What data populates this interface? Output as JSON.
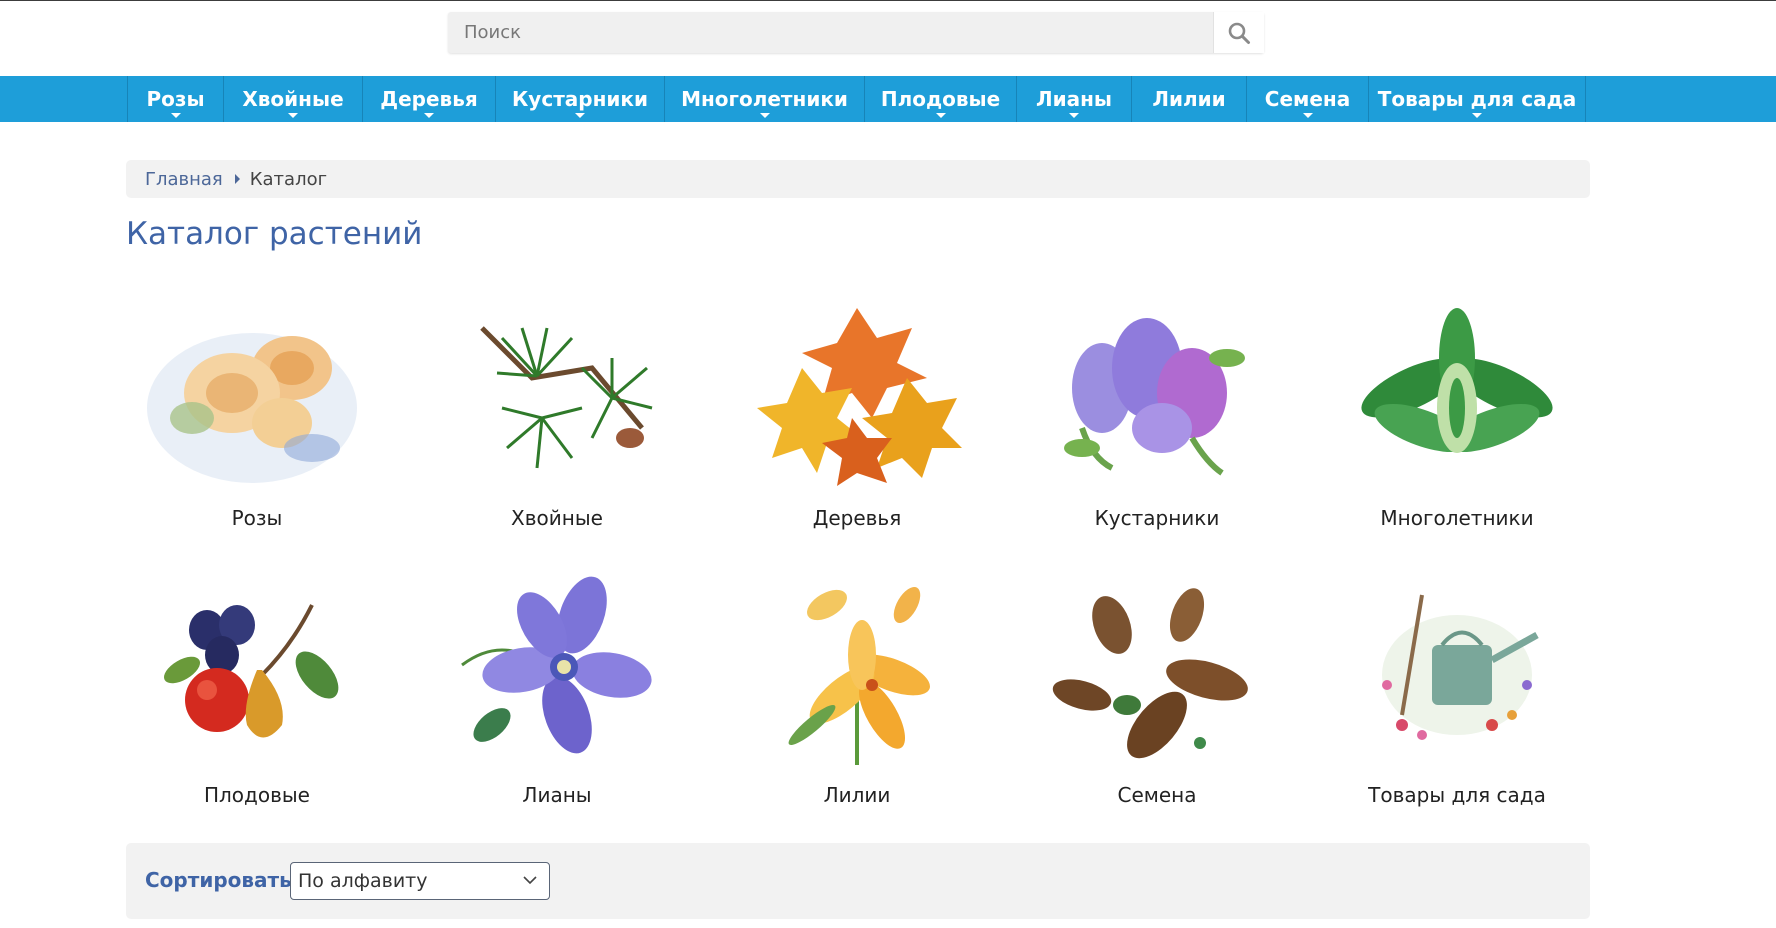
{
  "search": {
    "placeholder": "Поиск",
    "value": ""
  },
  "nav": [
    {
      "label": "Розы",
      "has_dropdown": true
    },
    {
      "label": "Хвойные",
      "has_dropdown": true
    },
    {
      "label": "Деревья",
      "has_dropdown": true
    },
    {
      "label": "Кустарники",
      "has_dropdown": true
    },
    {
      "label": "Многолетники",
      "has_dropdown": true
    },
    {
      "label": "Плодовые",
      "has_dropdown": true
    },
    {
      "label": "Лианы",
      "has_dropdown": true
    },
    {
      "label": "Лилии",
      "has_dropdown": false
    },
    {
      "label": "Семена",
      "has_dropdown": true
    },
    {
      "label": "Товары для сада",
      "has_dropdown": true
    }
  ],
  "breadcrumb": {
    "home": "Главная",
    "current": "Каталог"
  },
  "page_title": "Каталог растений",
  "categories": [
    {
      "label": "Розы",
      "icon": "roses-image"
    },
    {
      "label": "Хвойные",
      "icon": "conifers-image"
    },
    {
      "label": "Деревья",
      "icon": "trees-image"
    },
    {
      "label": "Кустарники",
      "icon": "shrubs-image"
    },
    {
      "label": "Многолетники",
      "icon": "perennials-image"
    },
    {
      "label": "Плодовые",
      "icon": "fruit-image"
    },
    {
      "label": "Лианы",
      "icon": "vines-image"
    },
    {
      "label": "Лилии",
      "icon": "lilies-image"
    },
    {
      "label": "Семена",
      "icon": "seeds-image"
    },
    {
      "label": "Товары для сада",
      "icon": "garden-goods-image"
    }
  ],
  "sort": {
    "label": "Сортировать:",
    "selected": "По алфавиту"
  },
  "colors": {
    "nav_bg": "#1e9ed9",
    "title": "#3f64a6",
    "link": "#4c6798"
  }
}
